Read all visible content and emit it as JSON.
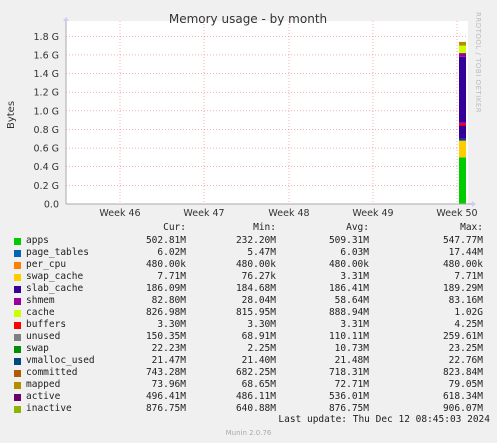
{
  "chart_data": {
    "type": "area",
    "title": "Memory usage - by month",
    "ylabel": "Bytes",
    "ylim": [
      0,
      1.9
    ],
    "y_ticks": [
      "0.0",
      "0.2 G",
      "0.4 G",
      "0.6 G",
      "0.8 G",
      "1.0 G",
      "1.2 G",
      "1.4 G",
      "1.6 G",
      "1.8 G"
    ],
    "y_tick_values": [
      0,
      0.2,
      0.4,
      0.6,
      0.8,
      1.0,
      1.2,
      1.4,
      1.6,
      1.8
    ],
    "x_ticks": [
      "Week 46",
      "Week 47",
      "Week 48",
      "Week 49",
      "Week 50"
    ],
    "grid": true,
    "series": [
      {
        "name": "apps",
        "color": "#00cc00",
        "cur": "502.81M",
        "min": "232.20M",
        "avg": "509.31M",
        "max": "547.77M"
      },
      {
        "name": "page_tables",
        "color": "#0066b3",
        "cur": "6.02M",
        "min": "5.47M",
        "avg": "6.03M",
        "max": "17.44M"
      },
      {
        "name": "per_cpu",
        "color": "#ff8000",
        "cur": "480.00k",
        "min": "480.00k",
        "avg": "480.00k",
        "max": "480.00k"
      },
      {
        "name": "swap_cache",
        "color": "#ffcc00",
        "cur": "7.71M",
        "min": "76.27k",
        "avg": "3.31M",
        "max": "7.71M"
      },
      {
        "name": "slab_cache",
        "color": "#330099",
        "cur": "186.09M",
        "min": "184.68M",
        "avg": "186.41M",
        "max": "189.29M"
      },
      {
        "name": "shmem",
        "color": "#990099",
        "cur": "82.80M",
        "min": "28.04M",
        "avg": "58.64M",
        "max": "83.16M"
      },
      {
        "name": "cache",
        "color": "#ccff00",
        "cur": "826.98M",
        "min": "815.95M",
        "avg": "888.94M",
        "max": "1.02G"
      },
      {
        "name": "buffers",
        "color": "#ff0000",
        "cur": "3.30M",
        "min": "3.30M",
        "avg": "3.31M",
        "max": "4.25M"
      },
      {
        "name": "unused",
        "color": "#808080",
        "cur": "150.35M",
        "min": "68.91M",
        "avg": "110.11M",
        "max": "259.61M"
      },
      {
        "name": "swap",
        "color": "#008f00",
        "cur": "22.23M",
        "min": "2.25M",
        "avg": "10.73M",
        "max": "23.25M"
      },
      {
        "name": "vmalloc_used",
        "color": "#00487d",
        "cur": "21.47M",
        "min": "21.40M",
        "avg": "21.48M",
        "max": "22.76M"
      },
      {
        "name": "committed",
        "color": "#b35a00",
        "cur": "743.28M",
        "min": "682.25M",
        "avg": "718.31M",
        "max": "823.84M"
      },
      {
        "name": "mapped",
        "color": "#b38f00",
        "cur": "73.96M",
        "min": "68.65M",
        "avg": "72.71M",
        "max": "79.05M"
      },
      {
        "name": "active",
        "color": "#6b006b",
        "cur": "496.41M",
        "min": "486.11M",
        "avg": "536.01M",
        "max": "618.34M"
      },
      {
        "name": "inactive",
        "color": "#8fb300",
        "cur": "876.75M",
        "min": "640.88M",
        "avg": "876.75M",
        "max": "906.07M"
      }
    ],
    "swatch_colors": [
      "#00cc00",
      "#0066b3",
      "#ffcc00",
      "#ff8000",
      "#ffcc00",
      "#008f00",
      "#330099",
      "#990099",
      "#ccff00",
      "#ff0000",
      "#808080",
      "#008f00",
      "#00487d",
      "#b35a00",
      "#b38f00",
      "#8fb300"
    ],
    "stack_segments": [
      {
        "color": "#00cc00",
        "from": 0.0,
        "to": 0.5
      },
      {
        "color": "#ffcc00",
        "from": 0.5,
        "to": 0.68
      },
      {
        "color": "#00487d",
        "from": 0.68,
        "to": 0.7
      },
      {
        "color": "#330099",
        "from": 0.7,
        "to": 0.86
      },
      {
        "color": "#990099",
        "from": 0.86,
        "to": 0.88
      },
      {
        "color": "#ff0000",
        "from": 0.84,
        "to": 0.86
      },
      {
        "color": "#330099",
        "from": 0.88,
        "to": 1.58
      },
      {
        "color": "#990099",
        "from": 1.58,
        "to": 1.62
      },
      {
        "color": "#ccff00",
        "from": 1.62,
        "to": 1.7
      },
      {
        "color": "#b38f00",
        "from": 1.7,
        "to": 1.74
      }
    ]
  },
  "legend_header": {
    "cur": "Cur:",
    "min": "Min:",
    "avg": "Avg:",
    "max": "Max:"
  },
  "footer": "Last update: Thu Dec 12 08:45:03 2024",
  "version": "Munin 2.0.76",
  "watermark": "RRDTOOL / TOBI OETIKER"
}
